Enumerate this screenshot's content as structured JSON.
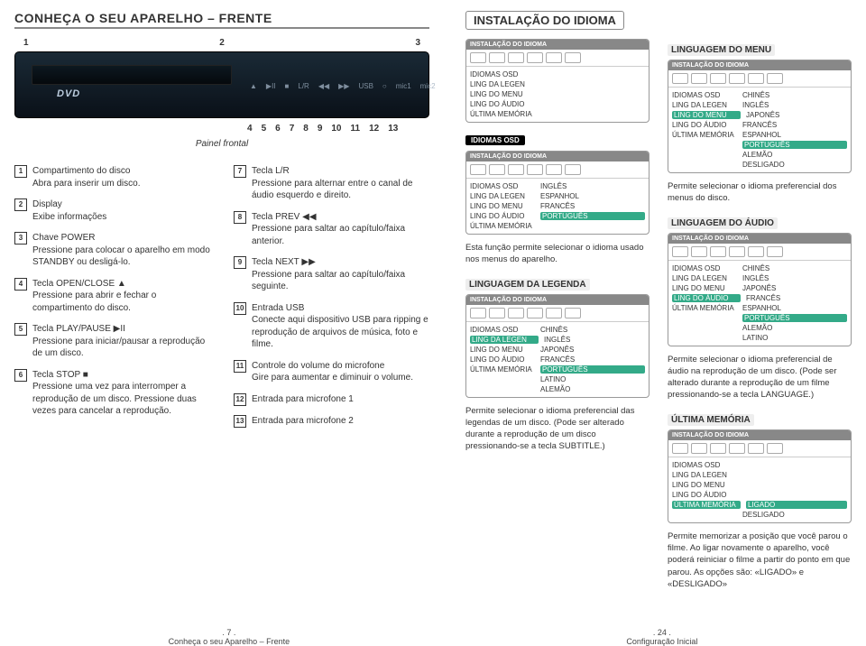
{
  "left": {
    "title": "CONHEÇA O SEU APARELHO – FRENTE",
    "top_nums": [
      "1",
      "2",
      "3"
    ],
    "bot_nums": [
      "4",
      "5",
      "6",
      "7",
      "8",
      "9",
      "10",
      "11",
      "12",
      "13"
    ],
    "dvd_logo": "DVD",
    "caption": "Painel frontal",
    "items_left": [
      {
        "n": "1",
        "t": "Compartimento do disco",
        "d": "Abra para inserir um disco."
      },
      {
        "n": "2",
        "t": "Display",
        "d": "Exibe informações"
      },
      {
        "n": "3",
        "t": "Chave POWER",
        "d": "Pressione para colocar o aparelho em modo STANDBY ou desligá-lo."
      },
      {
        "n": "4",
        "t": "Tecla OPEN/CLOSE ▲",
        "d": "Pressione para abrir e fechar o compartimento do disco."
      },
      {
        "n": "5",
        "t": "Tecla PLAY/PAUSE ▶II",
        "d": "Pressione para iniciar/pausar a reprodução de um disco."
      },
      {
        "n": "6",
        "t": "Tecla STOP ■",
        "d": "Pressione uma vez para interromper a reprodução de um disco. Pressione duas vezes para cancelar a reprodução."
      }
    ],
    "items_right": [
      {
        "n": "7",
        "t": "Tecla L/R",
        "d": "Pressione para alternar entre o canal de áudio esquerdo e direito."
      },
      {
        "n": "8",
        "t": "Tecla PREV ◀◀",
        "d": "Pressione para saltar ao capítulo/faixa anterior."
      },
      {
        "n": "9",
        "t": "Tecla NEXT ▶▶",
        "d": "Pressione para saltar ao capítulo/faixa seguinte."
      },
      {
        "n": "10",
        "t": "Entrada USB",
        "d": "Conecte aqui dispositivo USB para ripping e reprodução de arquivos de música, foto e filme."
      },
      {
        "n": "11",
        "t": "Controle do volume do microfone",
        "d": "Gire para aumentar e diminuir o volume."
      },
      {
        "n": "12",
        "t": "Entrada para microfone 1",
        "d": ""
      },
      {
        "n": "13",
        "t": "Entrada para microfone 2",
        "d": ""
      }
    ]
  },
  "right": {
    "title": "INSTALAÇÃO DO IDIOMA",
    "lm_title": "LINGUAGEM DO MENU",
    "card_hdr": "INSTALAÇÃO DO IDIOMA",
    "menu_rows": [
      "IDIOMAS OSD",
      "LING DA LEGEN",
      "LING DO MENU",
      "LING DO ÁUDIO",
      "ÚLTIMA MEMÓRIA"
    ],
    "lang_opts": [
      "CHINÊS",
      "INGLÊS",
      "JAPONÊS",
      "FRANCÊS",
      "ESPANHOL",
      "PORTUGUÊS",
      "ALEMÃO",
      "DESLIGADO"
    ],
    "lm_desc": "Permite selecionar o idioma preferencial dos menus do disco.",
    "osd_chip": "IDIOMAS OSD",
    "osd_rows": [
      [
        "IDIOMAS OSD",
        "INGLÊS"
      ],
      [
        "LING DA LEGEN",
        "ESPANHOL"
      ],
      [
        "LING DO MENU",
        "FRANCÊS"
      ],
      [
        "LING DO ÁUDIO",
        "PORTUGUÊS"
      ],
      [
        "ÚLTIMA MEMÓRIA",
        ""
      ]
    ],
    "osd_desc": "Esta função permite selecionar o idioma usado nos menus do aparelho.",
    "ll_title": "LINGUAGEM DA LEGENDA",
    "ll_rows": [
      [
        "IDIOMAS OSD",
        "CHINÊS"
      ],
      [
        "LING DA LEGEN",
        "INGLÊS"
      ],
      [
        "LING DO MENU",
        "JAPONÊS"
      ],
      [
        "LING DO ÁUDIO",
        "FRANCÊS"
      ],
      [
        "ÚLTIMA MEMÓRIA",
        "PORTUGUÊS"
      ],
      [
        "",
        "LATINO"
      ],
      [
        "",
        "ALEMÃO"
      ]
    ],
    "ll_desc": "Permite selecionar o idioma preferencial das legendas de um disco. (Pode ser alterado durante a reprodução de um disco pressionando-se a tecla SUBTITLE.)",
    "la_title": "LINGUAGEM DO ÁUDIO",
    "la_rows": [
      [
        "IDIOMAS OSD",
        "CHINÊS"
      ],
      [
        "LING DA LEGEN",
        "INGLÊS"
      ],
      [
        "LING DO MENU",
        "JAPONÊS"
      ],
      [
        "LING DO ÁUDIO",
        "FRANCÊS"
      ],
      [
        "ÚLTIMA MEMÓRIA",
        "ESPANHOL"
      ],
      [
        "",
        "PORTUGUÊS"
      ],
      [
        "",
        "ALEMÃO"
      ],
      [
        "",
        "LATINO"
      ]
    ],
    "la_desc": "Permite selecionar o idioma preferencial de áudio na reprodução de um disco. (Pode ser alterado durante a reprodução de um filme pressionando-se a tecla LANGUAGE.)",
    "um_title": "ÚLTIMA MEMÓRIA",
    "um_rows": [
      [
        "IDIOMAS OSD",
        ""
      ],
      [
        "LING DA LEGEN",
        ""
      ],
      [
        "LING DO MENU",
        ""
      ],
      [
        "LING DO ÁUDIO",
        ""
      ],
      [
        "ÚLTIMA MEMÓRIA",
        "LIGADO"
      ],
      [
        "",
        "DESLIGADO"
      ]
    ],
    "um_desc": "Permite memorizar a posição que você parou o filme. Ao ligar novamente o aparelho, você poderá reiniciar o filme a partir do ponto em que parou. As opções são: «LIGADO» e «DESLIGADO»"
  },
  "footer": {
    "l_num": ". 7 .",
    "l_txt": "Conheça o seu Aparelho – Frente",
    "r_num": ". 24 .",
    "r_txt": "Configuração Inicial"
  }
}
